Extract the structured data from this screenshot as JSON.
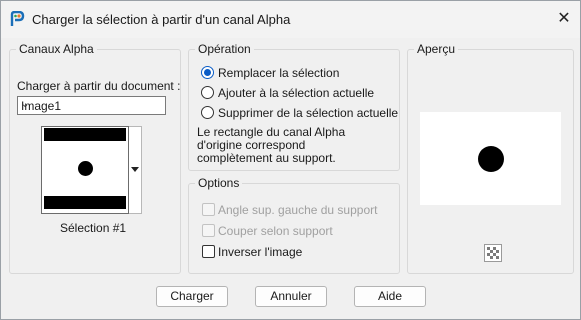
{
  "window": {
    "title": "Charger la sélection à partir d'un canal Alpha"
  },
  "alpha_group": {
    "title": "Canaux Alpha",
    "doc_label": "Charger à partir du document :",
    "doc_value": "Image1",
    "selection_label": "Sélection #1"
  },
  "operation_group": {
    "title": "Opération",
    "options": [
      {
        "label": "Remplacer la sélection",
        "selected": true
      },
      {
        "label": "Ajouter à la sélection actuelle",
        "selected": false
      },
      {
        "label": "Supprimer de la sélection actuelle",
        "selected": false
      }
    ],
    "note_lines": [
      "Le rectangle du canal Alpha",
      "d'origine correspond",
      "complètement au support."
    ]
  },
  "options_group": {
    "title": "Options",
    "items": [
      {
        "label": "Angle sup. gauche du support",
        "checked": false,
        "enabled": false
      },
      {
        "label": "Couper selon support",
        "checked": false,
        "enabled": false
      },
      {
        "label": "Inverser l'image",
        "checked": false,
        "enabled": true
      }
    ]
  },
  "preview_group": {
    "title": "Aperçu"
  },
  "buttons": {
    "ok": "Charger",
    "cancel": "Annuler",
    "help": "Aide"
  },
  "colors": {
    "radio_accent": "#0a5cc6",
    "dialog_bg": "#f0f0f0"
  }
}
